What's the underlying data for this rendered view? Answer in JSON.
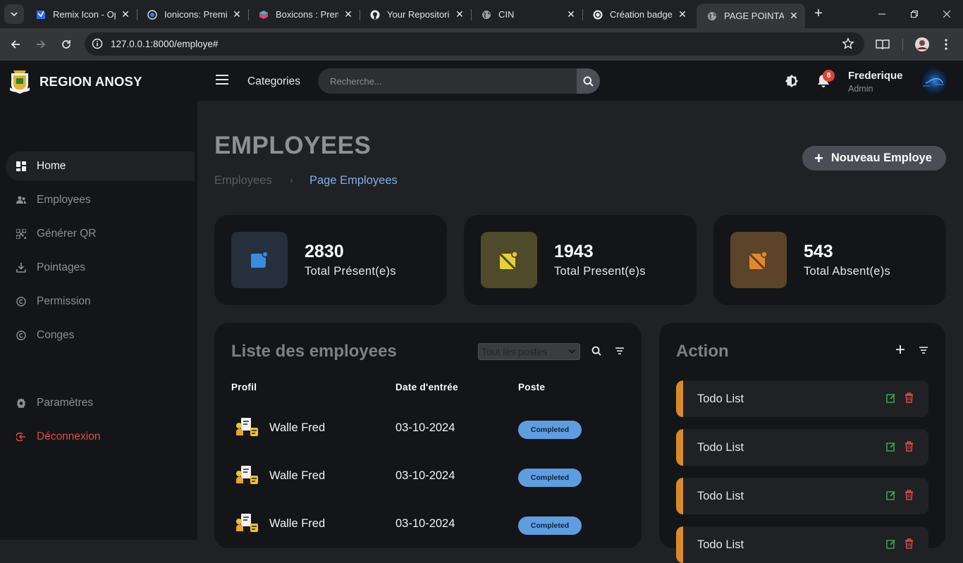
{
  "browser": {
    "tabs": [
      {
        "title": "Remix Icon - Open source icon library",
        "icon": "remixicon-icon"
      },
      {
        "title": "Ionicons: Premium Open Source Icons",
        "icon": "ionicons-icon"
      },
      {
        "title": "Boxicons : Premium icons",
        "icon": "boxicons-icon"
      },
      {
        "title": "Your Repositories",
        "icon": "github-icon"
      },
      {
        "title": "CIN",
        "icon": "globe-icon"
      },
      {
        "title": "Création badge",
        "icon": "openai-icon"
      },
      {
        "title": "PAGE POINTAGE",
        "icon": "globe-icon",
        "active": true
      }
    ],
    "url": "127.0.0.1:8000/employe#"
  },
  "header": {
    "brand": "REGION ANOSY",
    "categories": "Categories",
    "search_placeholder": "Recherche...",
    "notification_count": "8",
    "user_name": "Frederique",
    "user_role": "Admin"
  },
  "sidebar": {
    "items": [
      {
        "label": "Home",
        "icon": "grid-icon",
        "active": true
      },
      {
        "label": "Employees",
        "icon": "users-icon"
      },
      {
        "label": "Générer QR",
        "icon": "qr-icon"
      },
      {
        "label": "Pointages",
        "icon": "download-icon"
      },
      {
        "label": "Permission",
        "icon": "copyright-icon"
      },
      {
        "label": "Conges",
        "icon": "copyright-icon"
      }
    ],
    "settings": "Paramètres",
    "logout": "Déconnexion"
  },
  "page": {
    "title": "EMPLOYEES",
    "breadcrumb": [
      "Employees",
      "Page Employees"
    ],
    "new_button": "Nouveau Employe"
  },
  "stats": [
    {
      "value": "2830",
      "label": "Total Présent(e)s",
      "color": "#3b8ae0",
      "bg": "#25303c"
    },
    {
      "value": "1943",
      "label": "Total Present(e)s",
      "color": "#e3d03a",
      "bg": "#4f4a2a"
    },
    {
      "value": "543",
      "label": "Total Absent(e)s",
      "color": "#e6872b",
      "bg": "#5b4429"
    }
  ],
  "employees": {
    "title": "Liste des employees",
    "filter_selected": "Tout les postes",
    "columns": [
      "Profil",
      "Date d'entrée",
      "Poste"
    ],
    "rows": [
      {
        "name": "Walle Fred",
        "date": "03-10-2024",
        "status": "Completed"
      },
      {
        "name": "Walle Fred",
        "date": "03-10-2024",
        "status": "Completed"
      },
      {
        "name": "Walle Fred",
        "date": "03-10-2024",
        "status": "Completed"
      }
    ]
  },
  "actions": {
    "title": "Action",
    "todos": [
      "Todo List",
      "Todo List",
      "Todo List",
      "Todo List"
    ]
  },
  "colors": {
    "accent_orange": "#d78a2a",
    "status_blue": "#5e9ee0",
    "logout_red": "#e04b43"
  }
}
